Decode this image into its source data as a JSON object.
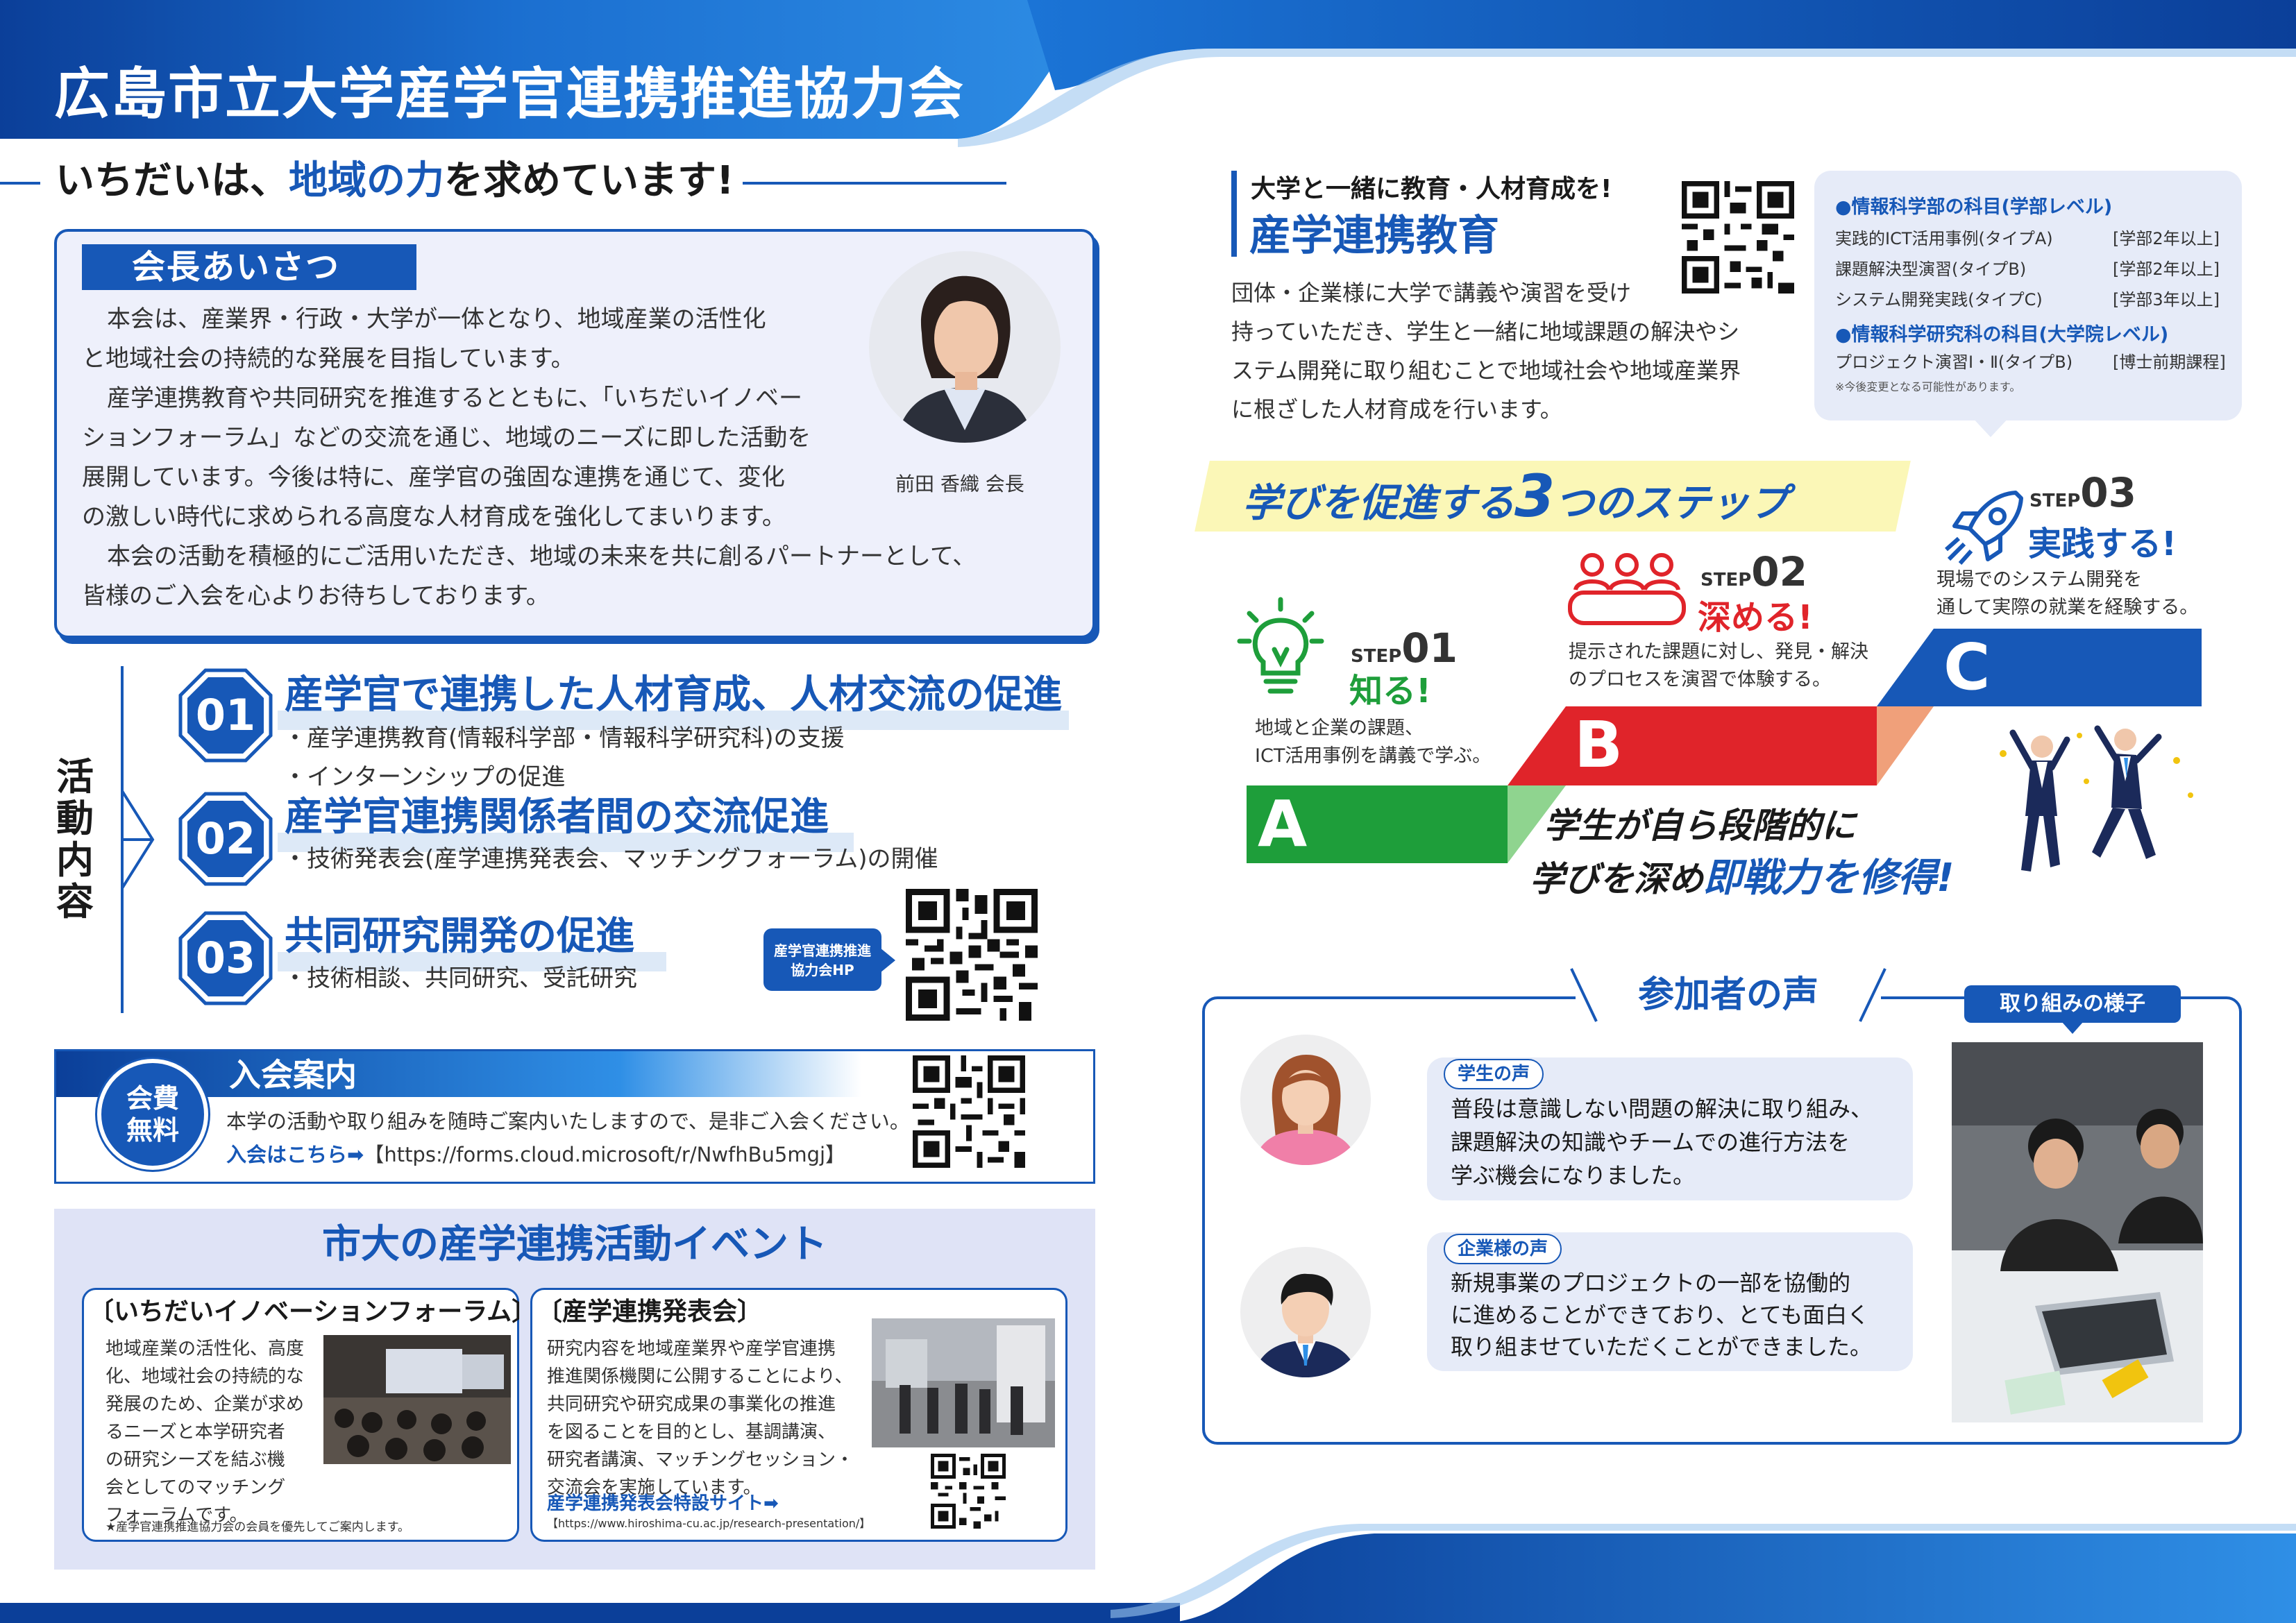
{
  "header": {
    "title": "広島市立大学産学官連携推進協力会",
    "tagline_prefix": "いちだいは、",
    "tagline_emph": "地域の力",
    "tagline_suffix": "を求めています!"
  },
  "greeting": {
    "heading": "会長あいさつ",
    "p1": "本会は、産業界・行政・大学が一体となり、地域産業の活性化",
    "p2": "と地域社会の持続的な発展を目指しています。",
    "p3": "産学連携教育や共同研究を推進するとともに、「いちだいイノベー",
    "p4": "ションフォーラム」などの交流を通じ、地域のニーズに即した活動を",
    "p5": "展開しています。今後は特に、産学官の強固な連携を通じて、変化",
    "p6": "の激しい時代に求められる高度な人材育成を強化してまいります。",
    "p7": "本会の活動を積極的にご活用いただき、地域の未来を共に創るパートナーとして、",
    "p8": "皆様のご入会を心よりお待ちしております。",
    "president": "前田 香織 会長"
  },
  "activities": {
    "side_label": [
      "活",
      "動",
      "内",
      "容"
    ],
    "items": [
      {
        "num": "01",
        "title": "産学官で連携した人材育成、人材交流の促進",
        "bullets": [
          "・産学連携教育(情報科学部・情報科学研究科)の支援",
          "・インターンシップの促進"
        ]
      },
      {
        "num": "02",
        "title": "産学官連携関係者間の交流促進",
        "bullets": [
          "・技術発表会(産学連携発表会、マッチングフォーラム)の開催"
        ]
      },
      {
        "num": "03",
        "title": "共同研究開発の促進",
        "bullets": [
          "・技術相談、共同研究、受託研究"
        ]
      }
    ],
    "hp_label_1": "産学官連携推進",
    "hp_label_2": "協力会HP"
  },
  "membership": {
    "badge_1": "会費",
    "badge_2": "無料",
    "title": "入会案内",
    "text": "本学の活動や取り組みを随時ご案内いたしますので、是非ご入会ください。",
    "link_label": "入会はこちら➡",
    "url": "【https://forms.cloud.microsoft/r/NwfhBu5mgj】"
  },
  "events": {
    "title": "市大の産学連携活動イベント",
    "forum": {
      "title": "いちだいイノベーションフォーラム",
      "lines": [
        "地域産業の活性化、高度",
        "化、地域社会の持続的な",
        "発展のため、企業が求め",
        "るニーズと本学研究者",
        "の研究シーズを結ぶ機",
        "会としてのマッチング",
        "フォーラムです。"
      ],
      "note": "★産学官連携推進協力会の会員を優先してご案内します。"
    },
    "presentation": {
      "title": "産学連携発表会",
      "lines": [
        "研究内容を地域産業界や産学官連携",
        "推進関係機関に公開することにより、",
        "共同研究や研究成果の事業化の推進",
        "を図ることを目的とし、基調講演、",
        "研究者講演、マッチングセッション・",
        "交流会を実施しています。"
      ],
      "link": "産学連携発表会特設サイト➡",
      "url": "【https://www.hiroshima-cu.ac.jp/research-presentation/】"
    }
  },
  "education": {
    "kicker": "大学と一緒に教育・人材育成を!",
    "title": "産学連携教育",
    "lines": [
      "団体・企業様に大学で講義や演習を受け",
      "持っていただき、学生と一緒に地域課題の解決やシ",
      "ステム開発に取り組むことで地域社会や地域産業界",
      "に根ざした人材育成を行います。"
    ],
    "courses_h1": "●情報科学部の科目(学部レベル)",
    "courses": [
      {
        "name": "実践的ICT活用事例(タイプA)",
        "level": "[学部2年以上]"
      },
      {
        "name": "課題解決型演習(タイプB)",
        "level": "[学部2年以上]"
      },
      {
        "name": "システム開発実践(タイプC)",
        "level": "[学部3年以上]"
      }
    ],
    "courses_h2": "●情報科学研究科の科目(大学院レベル)",
    "grad_name": "プロジェクト演習Ⅰ・Ⅱ(タイプB)",
    "grad_level": "[博士前期課程]",
    "note": "※今後変更となる可能性があります。"
  },
  "steps": {
    "title_pre": "学びを促進する",
    "title_num": "3",
    "title_post": "つのステップ",
    "step_word": "STEP",
    "s1": {
      "num": "01",
      "name": "知る!",
      "d1": "地域と企業の課題、",
      "d2": "ICT活用事例を講義で学ぶ。",
      "letter": "A"
    },
    "s2": {
      "num": "02",
      "name": "深める!",
      "d1": "提示された課題に対し、発見・解決",
      "d2": "のプロセスを演習で体験する。",
      "letter": "B"
    },
    "s3": {
      "num": "03",
      "name": "実践する!",
      "d1": "現場でのシステム開発を",
      "d2": "通して実際の就業を経験する。",
      "letter": "C"
    },
    "summary_1": "学生が自ら段階的に",
    "summary_2a": "学びを深め",
    "summary_2b": "即戦力を修得!",
    "colors": {
      "A": "#1e9e3a",
      "B": "#e0242a",
      "C": "#1758b7"
    }
  },
  "voices": {
    "title": "参加者の声",
    "photo_label": "取り組みの様子",
    "student": {
      "tag": "学生の声",
      "lines": [
        "普段は意識しない問題の解決に取り組み、",
        "課題解決の知識やチームでの進行方法を",
        "学ぶ機会になりました。"
      ]
    },
    "company": {
      "tag": "企業様の声",
      "lines": [
        "新規事業のプロジェクトの一部を協働的",
        "に進めることができており、とても面白く",
        "取り組ませていただくことができました。"
      ]
    }
  }
}
